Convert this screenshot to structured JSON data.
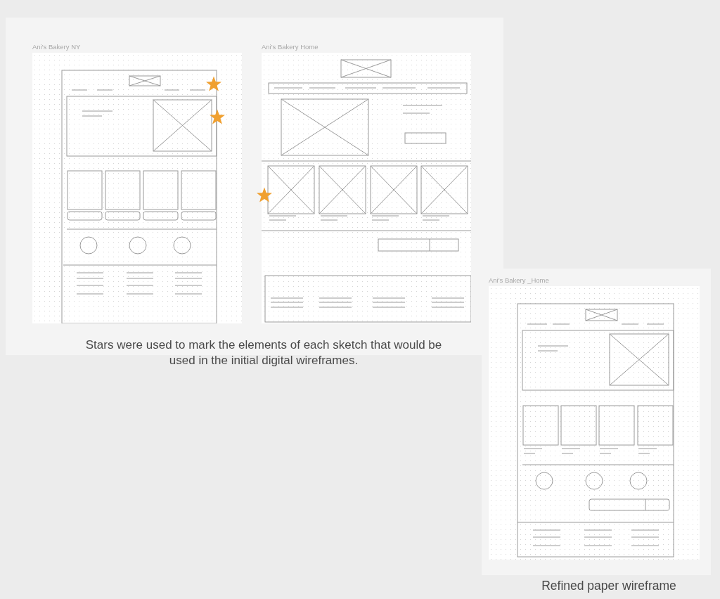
{
  "panels": [
    {
      "frames": [
        {
          "title": "Ani's Bakery NY",
          "kind": "sketch-ny"
        },
        {
          "title": "Ani's Bakery Home",
          "kind": "sketch-home"
        }
      ],
      "caption": "Stars were used to mark the elements of each sketch that would be used in the initial digital wireframes."
    },
    {
      "frames": [
        {
          "title": "Ani's Bakery _Home",
          "kind": "refined"
        }
      ],
      "caption": "Refined paper wireframe"
    }
  ]
}
